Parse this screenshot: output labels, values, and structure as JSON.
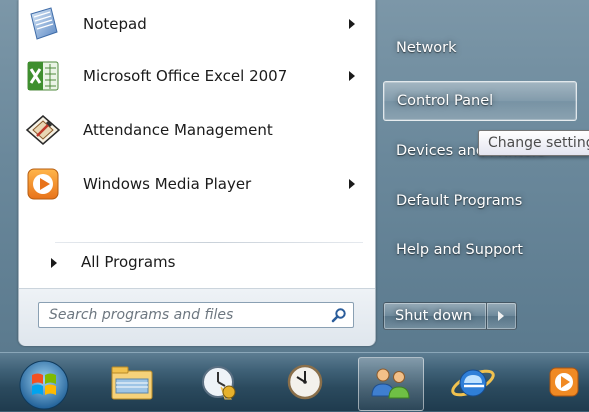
{
  "start_menu": {
    "programs": [
      {
        "label": "Notepad",
        "icon": "notepad-icon",
        "has_submenu": true
      },
      {
        "label": "Microsoft Office Excel 2007",
        "icon": "excel-icon",
        "has_submenu": true
      },
      {
        "label": "Attendance Management",
        "icon": "attendance-management-icon",
        "has_submenu": false
      },
      {
        "label": "Windows Media Player",
        "icon": "windows-media-player-icon",
        "has_submenu": true
      }
    ],
    "all_programs_label": "All Programs",
    "search": {
      "placeholder": "Search programs and files",
      "value": ""
    },
    "right_pane": {
      "items": [
        {
          "label": "Network"
        },
        {
          "label": "Control Panel",
          "highlighted": true
        },
        {
          "label": "Devices and Printers"
        },
        {
          "label": "Default Programs"
        },
        {
          "label": "Help and Support"
        }
      ],
      "shutdown_label": "Shut down"
    },
    "tooltip": "Change settings"
  },
  "taskbar": {
    "buttons": [
      {
        "icon": "start-orb-icon"
      },
      {
        "icon": "windows-explorer-icon"
      },
      {
        "icon": "network-time-icon"
      },
      {
        "icon": "clock-icon"
      },
      {
        "icon": "users-icon",
        "active": true
      },
      {
        "icon": "internet-explorer-icon"
      },
      {
        "icon": "windows-media-player-icon"
      }
    ]
  },
  "colors": {
    "menu_left_bg": "#ffffff",
    "glass": "#6a889b",
    "taskbar": "#2b4a5e"
  }
}
